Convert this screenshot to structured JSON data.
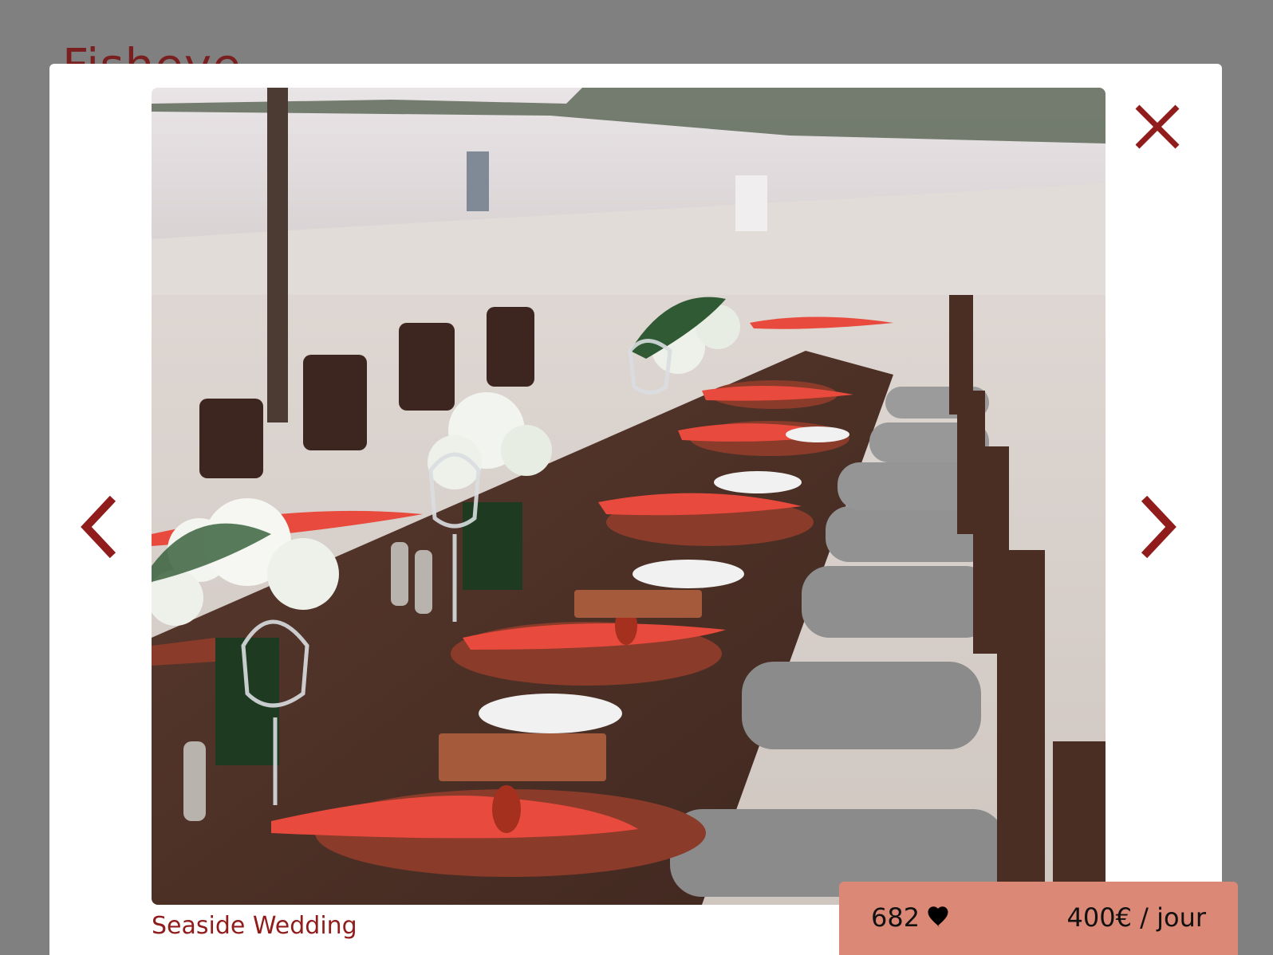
{
  "background": {
    "logo_text": "Fisheye"
  },
  "lightbox": {
    "media_title": "Seaside Wedding",
    "media_alt": "Long wooden table set with red napkins on a beach",
    "prev_icon": "chevron-left-icon",
    "next_icon": "chevron-right-icon",
    "close_icon": "close-icon"
  },
  "info_bar": {
    "likes": "682",
    "like_icon": "heart-icon",
    "price": "400€ / jour"
  },
  "colors": {
    "overlay": "#808080",
    "accent": "#901c1c",
    "info_bar": "#db8876"
  }
}
